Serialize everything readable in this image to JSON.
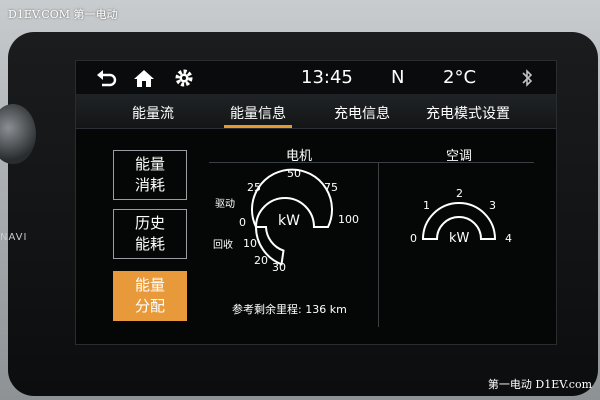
{
  "watermark": {
    "top": "D1EV.COM 第一电动",
    "bottom": "第一电动 D1EV.com"
  },
  "bezel": {
    "navi_label": "NAVI"
  },
  "status_bar": {
    "time": "13:45",
    "gear": "N",
    "temperature": "2°C"
  },
  "tabs": [
    {
      "label": "能量流",
      "active": false
    },
    {
      "label": "能量信息",
      "active": true
    },
    {
      "label": "充电信息",
      "active": false
    },
    {
      "label": "充电模式设置",
      "active": false
    }
  ],
  "side_buttons": [
    {
      "line1": "能量",
      "line2": "消耗",
      "active": false
    },
    {
      "line1": "历史",
      "line2": "能耗",
      "active": false
    },
    {
      "line1": "能量",
      "line2": "分配",
      "active": true
    }
  ],
  "motor_gauge": {
    "title": "电机",
    "unit": "kW",
    "drive_label": "驱动",
    "regen_label": "回收",
    "drive_ticks": [
      "0",
      "25",
      "50",
      "75",
      "100"
    ],
    "regen_ticks": [
      "10",
      "20",
      "30"
    ]
  },
  "ac_gauge": {
    "title": "空调",
    "unit": "kW",
    "ticks": [
      "0",
      "1",
      "2",
      "3",
      "4"
    ]
  },
  "range": {
    "text": "参考剩余里程: 136 km"
  },
  "colors": {
    "accent": "#e39a2f",
    "active_button": "#e89a3b",
    "gauge": "#ffffff"
  }
}
